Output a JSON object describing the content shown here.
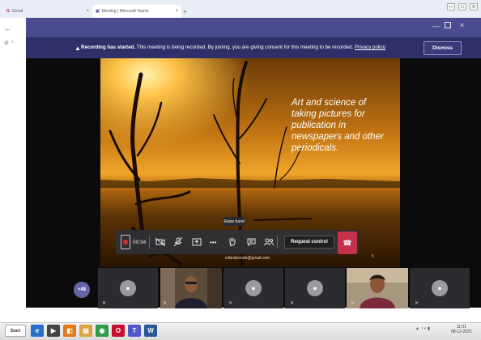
{
  "browser": {
    "tabs": [
      {
        "label": "Gmail",
        "close": "×"
      },
      {
        "label": "Meeting | Microsoft Teams",
        "close": "×"
      }
    ],
    "new_tab": "+",
    "window_controls": [
      "—",
      "□",
      "✕"
    ]
  },
  "teams_window": {
    "title_controls": {
      "minimize": "—",
      "close": "×"
    }
  },
  "recording_banner": {
    "title": "Recording has started.",
    "message": "This meeting is being recorded. By joining, you are giving consent for this meeting to be recorded.",
    "link": "Privacy policy",
    "dismiss": "Dismiss"
  },
  "slide": {
    "lines": [
      "Art and science of",
      "taking pictures for",
      "publication in",
      "newspapers and other",
      "periodicals."
    ],
    "email": "cebrakonule@gmail.com",
    "page": "5"
  },
  "controls": {
    "timer": "00:34",
    "tooltip": "Raise hand",
    "request_control": "Request control",
    "icons": {
      "camera": "camera-off-icon",
      "mic": "mic-off-icon",
      "share": "share-icon",
      "more": "more-icon",
      "hand": "raise-hand-icon",
      "chat": "chat-icon",
      "people": "participants-icon",
      "hangup": "hangup-icon"
    },
    "colors": {
      "hangup": "#c4314b",
      "record": "#d92c2c"
    }
  },
  "participants": {
    "overflow": "+48"
  },
  "taskbar": {
    "start": "Start",
    "clock_time": "11:01",
    "clock_date": "08-12-2021"
  }
}
